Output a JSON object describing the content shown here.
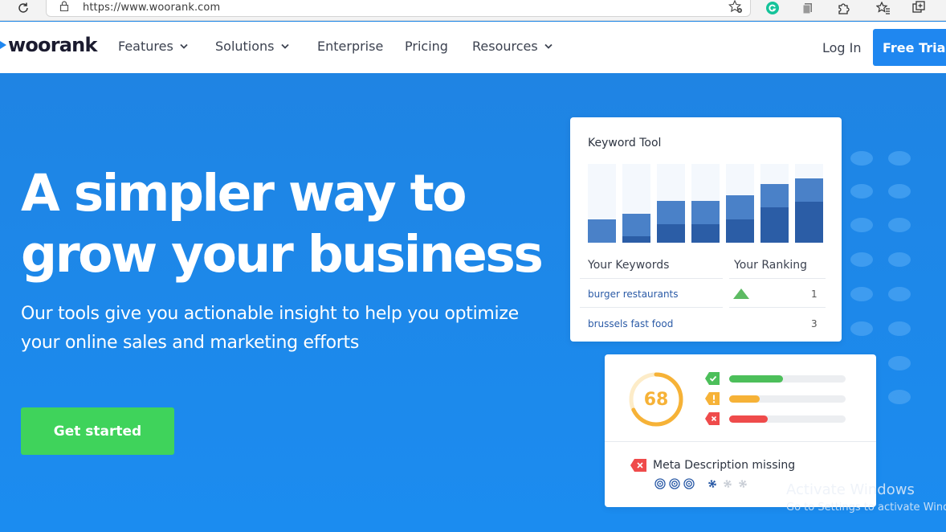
{
  "browser": {
    "url": "https://www.woorank.com"
  },
  "nav": {
    "logo": "woorank",
    "items": [
      {
        "label": "Features",
        "dropdown": true
      },
      {
        "label": "Solutions",
        "dropdown": true
      },
      {
        "label": "Enterprise",
        "dropdown": false
      },
      {
        "label": "Pricing",
        "dropdown": false
      },
      {
        "label": "Resources",
        "dropdown": true
      }
    ],
    "login": "Log In",
    "trial": "Free Trial"
  },
  "hero": {
    "title_line1": "A simpler way to",
    "title_line2": "grow your business",
    "subtitle_line1": "Our tools give you actionable insight to help you optimize",
    "subtitle_line2": "your online sales and marketing efforts",
    "cta": "Get started"
  },
  "keyword_card": {
    "title": "Keyword Tool",
    "col_keywords": "Your Keywords",
    "col_ranking": "Your Ranking",
    "rows": [
      {
        "keyword": "burger restaurants",
        "rank": "1"
      },
      {
        "keyword": "brussels fast food",
        "rank": "3"
      }
    ],
    "bars": [
      {
        "total": 0.3,
        "dark": 0.0
      },
      {
        "total": 0.37,
        "dark": 0.08
      },
      {
        "total": 0.53,
        "dark": 0.23
      },
      {
        "total": 0.53,
        "dark": 0.23
      },
      {
        "total": 0.6,
        "dark": 0.3
      },
      {
        "total": 0.74,
        "dark": 0.45
      },
      {
        "total": 0.82,
        "dark": 0.52
      }
    ]
  },
  "score_card": {
    "score": "68",
    "score_fraction": 0.68,
    "stats": [
      {
        "type": "pass",
        "color": "#4cbf5a",
        "fill": 0.46
      },
      {
        "type": "warning",
        "color": "#f6b237",
        "fill": 0.26
      },
      {
        "type": "error",
        "color": "#ef4b4b",
        "fill": 0.33
      }
    ],
    "issue": "Meta Description missing"
  },
  "watermark": {
    "line1": "Activate Windows",
    "line2": "Go to Settings to activate Windows."
  },
  "colors": {
    "brand_blue": "#1f87f0",
    "cta_green": "#3fd35b",
    "score_orange": "#f6b237"
  }
}
